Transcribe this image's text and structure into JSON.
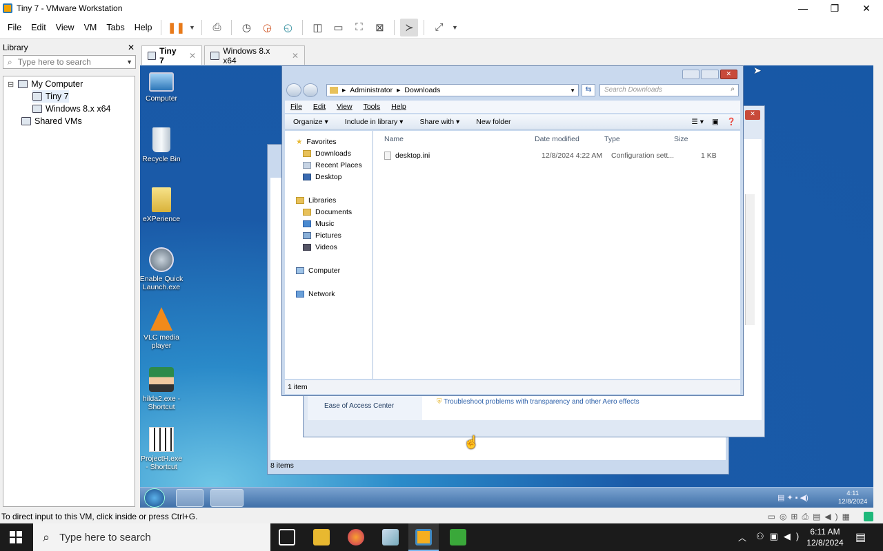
{
  "window": {
    "title": "Tiny 7 - VMware Workstation",
    "controls": {
      "minimize": "—",
      "maximize": "❐",
      "close": "✕"
    }
  },
  "menu": [
    "File",
    "Edit",
    "View",
    "VM",
    "Tabs",
    "Help"
  ],
  "library": {
    "title": "Library",
    "close": "✕",
    "search_placeholder": "Type here to search",
    "tree": [
      {
        "label": "My Computer",
        "level": 0,
        "toggle": "⊟"
      },
      {
        "label": "Tiny 7",
        "level": 1
      },
      {
        "label": "Windows 8.x x64",
        "level": 1
      },
      {
        "label": "Shared VMs",
        "level": 0
      }
    ]
  },
  "tabs": [
    {
      "label": "Tiny 7",
      "active": true,
      "close": "✕"
    },
    {
      "label": "Windows 8.x x64",
      "active": false,
      "close": "✕"
    }
  ],
  "desktop_icons": [
    "Computer",
    "Recycle Bin",
    "eXPerience",
    "Enable Quick Launch.exe",
    "VLC media player",
    "hilda2.exe - Shortcut",
    "ProjectH.exe - Shortcut"
  ],
  "explorer": {
    "breadcrumb": [
      "Administrator",
      "Downloads"
    ],
    "search_placeholder": "Search Downloads",
    "menu": [
      "File",
      "Edit",
      "View",
      "Tools",
      "Help"
    ],
    "commands": [
      "Organize ▾",
      "Include in library ▾",
      "Share with ▾",
      "New folder"
    ],
    "nav": {
      "favorites": "Favorites",
      "fav_items": [
        "Downloads",
        "Recent Places",
        "Desktop"
      ],
      "libraries": "Libraries",
      "lib_items": [
        "Documents",
        "Music",
        "Pictures",
        "Videos"
      ],
      "computer": "Computer",
      "network": "Network"
    },
    "columns": {
      "name": "Name",
      "date": "Date modified",
      "type": "Type",
      "size": "Size"
    },
    "files": [
      {
        "name": "desktop.ini",
        "date": "12/8/2024 4:22 AM",
        "type": "Configuration sett...",
        "size": "1 KB"
      }
    ],
    "status": "1 item"
  },
  "bg_window": {
    "left_item": "Ease of Access Center",
    "link": "Troubleshoot problems with transparency and other Aero effects"
  },
  "bg_window2": {
    "status": "8 items"
  },
  "guest_clock": {
    "time": "4:11",
    "date": "12/8/2024"
  },
  "vm_status": "To direct input to this VM, click inside or press Ctrl+G.",
  "host_taskbar": {
    "search": "Type here to search",
    "time": "6:11 AM",
    "date": "12/8/2024"
  }
}
